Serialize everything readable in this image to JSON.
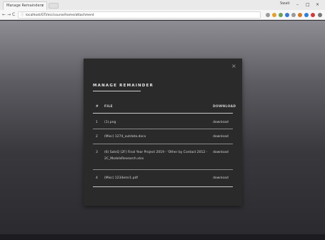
{
  "browser": {
    "tab_title": "Manage Remainders",
    "tab_close": "×",
    "user_label": "Swati",
    "window_controls": [
      "–",
      "□",
      "×"
    ],
    "nav": [
      "←",
      "→",
      "C"
    ],
    "url": "localhost/GTI/eic/course/home/attachment"
  },
  "modal": {
    "title": "MANAGE REMAINDER",
    "close": "×",
    "columns": {
      "number": "#",
      "file": "FILE",
      "download": "DOWNLOAD"
    },
    "rows": [
      {
        "number": "1",
        "file": "(1).png",
        "action": "download"
      },
      {
        "number": "2",
        "file": "(Misc) 1274_outdata.docx",
        "action": "download"
      },
      {
        "number": "3",
        "file": "(6) SatsQ (2F) Final Year Project 2019 - 'Other by Contact 2012 - 2C_ModelsResearch.xlsx",
        "action": "download"
      },
      {
        "number": "4",
        "file": "(Misc) 1234emr1.pdf",
        "action": "download"
      }
    ]
  },
  "colors": {
    "modal_bg": "#2a2a2a",
    "text": "#d6d6d6",
    "divider": "#8a8a8a"
  }
}
